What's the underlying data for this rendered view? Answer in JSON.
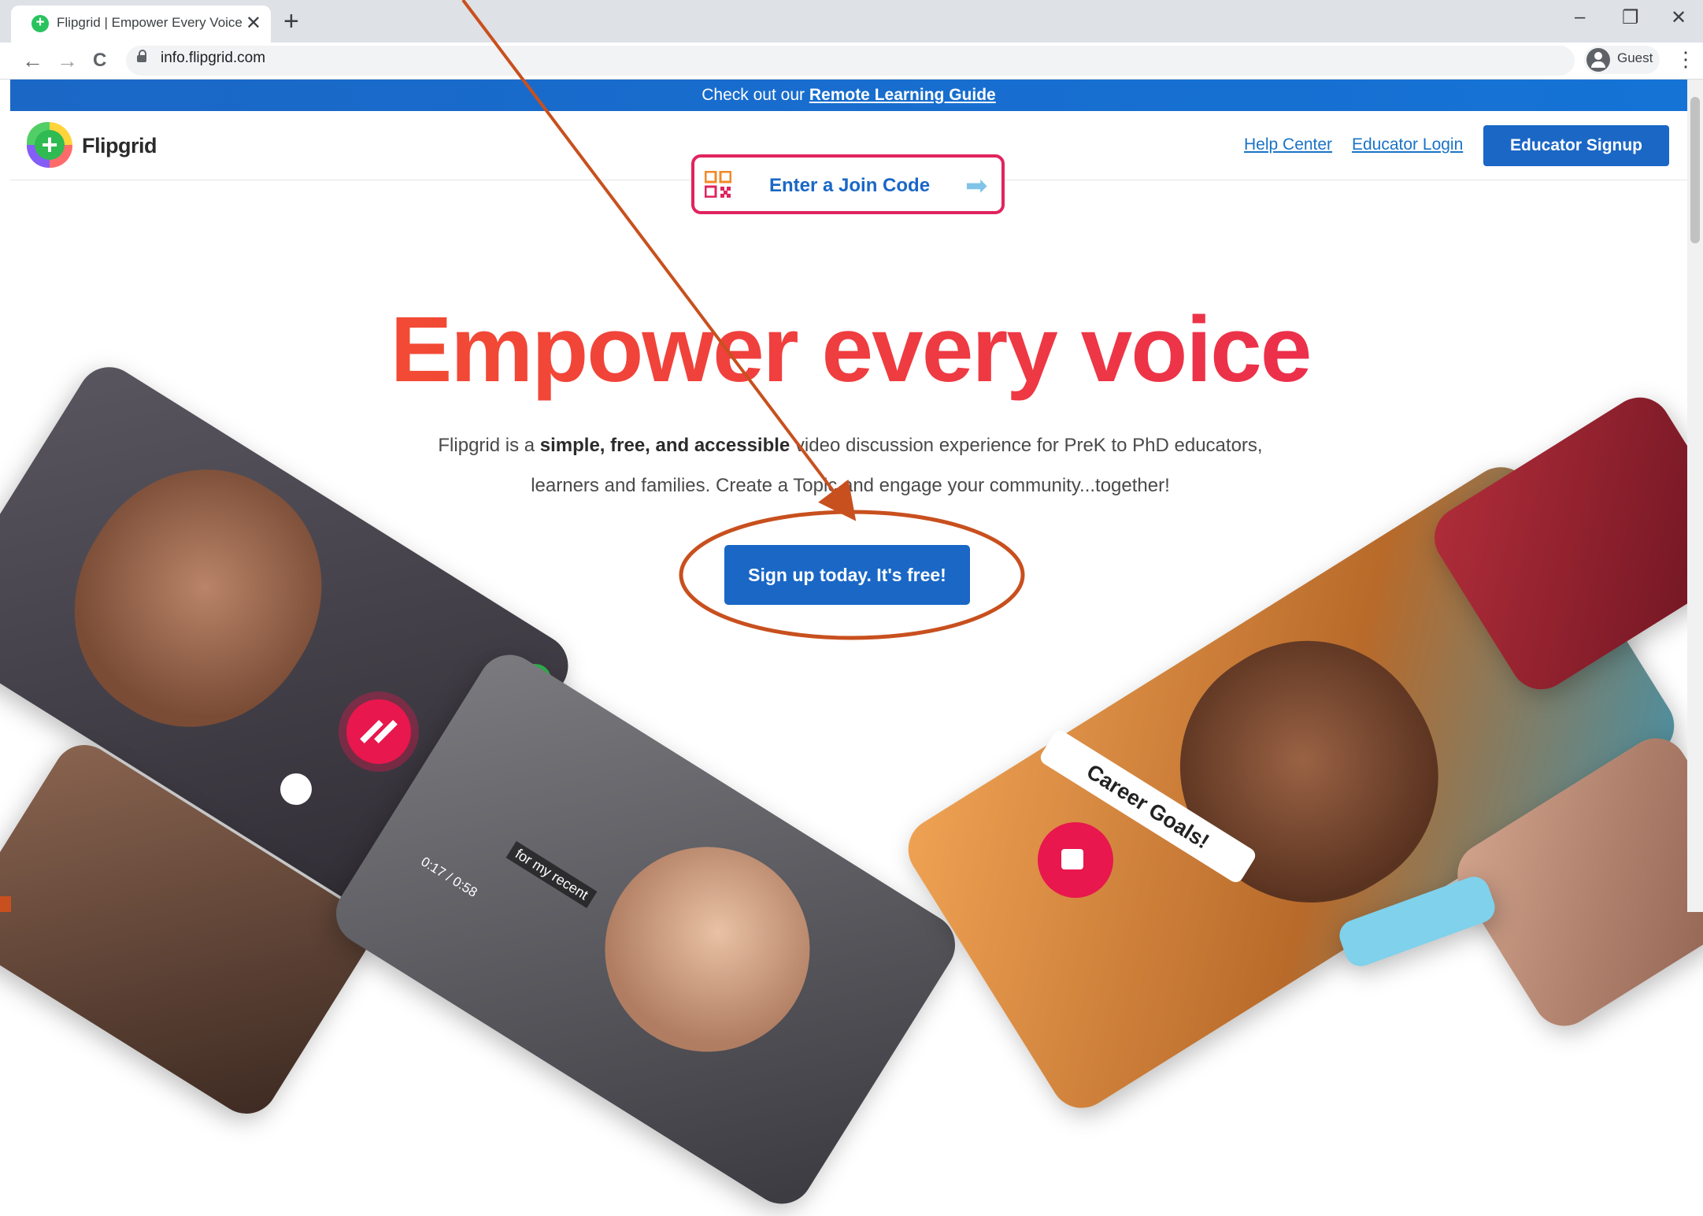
{
  "browser": {
    "tab_title": "Flipgrid | Empower Every Voice",
    "tab_close": "✕",
    "new_tab": "+",
    "url": "info.flipgrid.com",
    "profile_label": "Guest",
    "back": "←",
    "forward": "→",
    "reload": "C",
    "menu": "⋮",
    "minimize": "–",
    "restore": "❐",
    "close": "✕"
  },
  "banner": {
    "prefix": "Check out our ",
    "link": "Remote Learning Guide"
  },
  "header": {
    "logo_text": "Flipgrid",
    "help_center": "Help Center",
    "educator_login": "Educator Login",
    "educator_signup": "Educator Signup"
  },
  "join": {
    "label": "Enter a Join Code",
    "arrow": "➡"
  },
  "hero": {
    "title": "Empower every voice",
    "line1_pre": "Flipgrid is a ",
    "line1_bold": "simple, free, and accessible",
    "line1_post": " video discussion experience for PreK to PhD educators,",
    "line2": "learners and families. Create a Topic and engage your community...together!",
    "cta": "Sign up today. It's free!"
  },
  "tiles": {
    "career_label": "Career Goals!",
    "video_time": "0:17 / 0:58",
    "recent_caption": "for my recent"
  },
  "colors": {
    "brand_blue": "#1a67c6",
    "join_border": "#e0245e",
    "title_start": "#f5562a",
    "title_end": "#e92455",
    "annotation": "#c8501e"
  }
}
